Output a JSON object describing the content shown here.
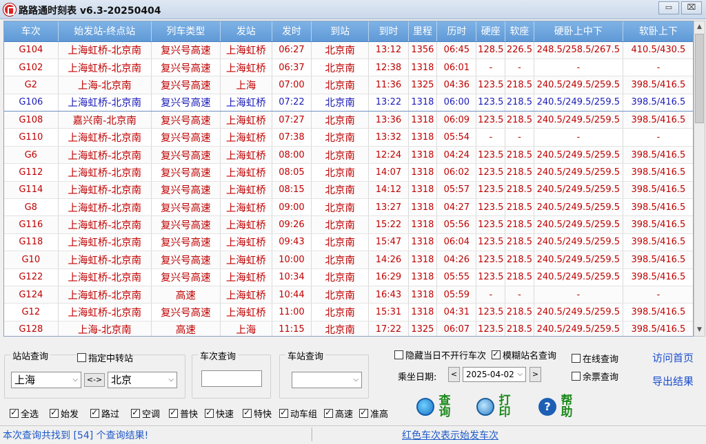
{
  "window": {
    "title": "路路通时刻表 v6.3-20250404",
    "minimize": "▭",
    "close": "⌧"
  },
  "table": {
    "headers": [
      "车次",
      "始发站-终点站",
      "列车类型",
      "发站",
      "发时",
      "到站",
      "到时",
      "里程",
      "历时",
      "硬座",
      "软座",
      "硬卧上中下",
      "软卧上下"
    ],
    "selected_row": 3,
    "rows": [
      [
        "G104",
        "上海虹桥-北京南",
        "复兴号高速",
        "上海虹桥",
        "06:27",
        "北京南",
        "13:12",
        "1356",
        "06:45",
        "128.5",
        "226.5",
        "248.5/258.5/267.5",
        "410.5/430.5"
      ],
      [
        "G102",
        "上海虹桥-北京南",
        "复兴号高速",
        "上海虹桥",
        "06:37",
        "北京南",
        "12:38",
        "1318",
        "06:01",
        "-",
        "-",
        "-",
        "-"
      ],
      [
        "G2",
        "上海-北京南",
        "复兴号高速",
        "上海",
        "07:00",
        "北京南",
        "11:36",
        "1325",
        "04:36",
        "123.5",
        "218.5",
        "240.5/249.5/259.5",
        "398.5/416.5"
      ],
      [
        "G106",
        "上海虹桥-北京南",
        "复兴号高速",
        "上海虹桥",
        "07:22",
        "北京南",
        "13:22",
        "1318",
        "06:00",
        "123.5",
        "218.5",
        "240.5/249.5/259.5",
        "398.5/416.5"
      ],
      [
        "G108",
        "嘉兴南-北京南",
        "复兴号高速",
        "上海虹桥",
        "07:27",
        "北京南",
        "13:36",
        "1318",
        "06:09",
        "123.5",
        "218.5",
        "240.5/249.5/259.5",
        "398.5/416.5"
      ],
      [
        "G110",
        "上海虹桥-北京南",
        "复兴号高速",
        "上海虹桥",
        "07:38",
        "北京南",
        "13:32",
        "1318",
        "05:54",
        "-",
        "-",
        "-",
        "-"
      ],
      [
        "G6",
        "上海虹桥-北京南",
        "复兴号高速",
        "上海虹桥",
        "08:00",
        "北京南",
        "12:24",
        "1318",
        "04:24",
        "123.5",
        "218.5",
        "240.5/249.5/259.5",
        "398.5/416.5"
      ],
      [
        "G112",
        "上海虹桥-北京南",
        "复兴号高速",
        "上海虹桥",
        "08:05",
        "北京南",
        "14:07",
        "1318",
        "06:02",
        "123.5",
        "218.5",
        "240.5/249.5/259.5",
        "398.5/416.5"
      ],
      [
        "G114",
        "上海虹桥-北京南",
        "复兴号高速",
        "上海虹桥",
        "08:15",
        "北京南",
        "14:12",
        "1318",
        "05:57",
        "123.5",
        "218.5",
        "240.5/249.5/259.5",
        "398.5/416.5"
      ],
      [
        "G8",
        "上海虹桥-北京南",
        "复兴号高速",
        "上海虹桥",
        "09:00",
        "北京南",
        "13:27",
        "1318",
        "04:27",
        "123.5",
        "218.5",
        "240.5/249.5/259.5",
        "398.5/416.5"
      ],
      [
        "G116",
        "上海虹桥-北京南",
        "复兴号高速",
        "上海虹桥",
        "09:26",
        "北京南",
        "15:22",
        "1318",
        "05:56",
        "123.5",
        "218.5",
        "240.5/249.5/259.5",
        "398.5/416.5"
      ],
      [
        "G118",
        "上海虹桥-北京南",
        "复兴号高速",
        "上海虹桥",
        "09:43",
        "北京南",
        "15:47",
        "1318",
        "06:04",
        "123.5",
        "218.5",
        "240.5/249.5/259.5",
        "398.5/416.5"
      ],
      [
        "G10",
        "上海虹桥-北京南",
        "复兴号高速",
        "上海虹桥",
        "10:00",
        "北京南",
        "14:26",
        "1318",
        "04:26",
        "123.5",
        "218.5",
        "240.5/249.5/259.5",
        "398.5/416.5"
      ],
      [
        "G122",
        "上海虹桥-北京南",
        "复兴号高速",
        "上海虹桥",
        "10:34",
        "北京南",
        "16:29",
        "1318",
        "05:55",
        "123.5",
        "218.5",
        "240.5/249.5/259.5",
        "398.5/416.5"
      ],
      [
        "G124",
        "上海虹桥-北京南",
        "高速",
        "上海虹桥",
        "10:44",
        "北京南",
        "16:43",
        "1318",
        "05:59",
        "-",
        "-",
        "-",
        "-"
      ],
      [
        "G12",
        "上海虹桥-北京南",
        "复兴号高速",
        "上海虹桥",
        "11:00",
        "北京南",
        "15:31",
        "1318",
        "04:31",
        "123.5",
        "218.5",
        "240.5/249.5/259.5",
        "398.5/416.5"
      ],
      [
        "G128",
        "上海-北京南",
        "高速",
        "上海",
        "11:15",
        "北京南",
        "17:22",
        "1325",
        "06:07",
        "123.5",
        "218.5",
        "240.5/249.5/259.5",
        "398.5/416.5"
      ]
    ]
  },
  "station_query": {
    "title": "站站查询",
    "via_label": "指定中转站",
    "from_value": "上海",
    "swap_label": "<->",
    "to_value": "北京"
  },
  "train_query": {
    "title": "车次查询",
    "value": ""
  },
  "station_lookup": {
    "title": "车站查询",
    "value": ""
  },
  "options": {
    "hide_not_running": "隐藏当日不开行车次",
    "fuzzy_station": "模糊站名查询",
    "online_query": "在线查询",
    "remaining_tickets": "余票查询"
  },
  "date": {
    "label": "乘坐日期:",
    "prev": "<",
    "value": "2025-04-02",
    "next": ">"
  },
  "filters": [
    {
      "label": "全选",
      "checked": true
    },
    {
      "label": "始发",
      "checked": true
    },
    {
      "label": "路过",
      "checked": true
    },
    {
      "label": "空调",
      "checked": true
    },
    {
      "label": "普快",
      "checked": true
    },
    {
      "label": "快速",
      "checked": true
    },
    {
      "label": "特快",
      "checked": true
    },
    {
      "label": "动车组",
      "checked": true
    },
    {
      "label": "高速",
      "checked": true
    },
    {
      "label": "准高",
      "checked": true
    }
  ],
  "actions": {
    "query": "查询",
    "print": "打印",
    "help": "帮助"
  },
  "links": {
    "home": "访问首页",
    "export": "导出结果"
  },
  "status": {
    "left": "本次查询共找到 [54] 个查询结果!",
    "right": "红色车次表示始发车次"
  },
  "colors": {
    "header": "#6aa4dc",
    "origin_train": "#c00000",
    "passing_train": "#1a1ab8",
    "action_green": "#1c8a1c"
  }
}
